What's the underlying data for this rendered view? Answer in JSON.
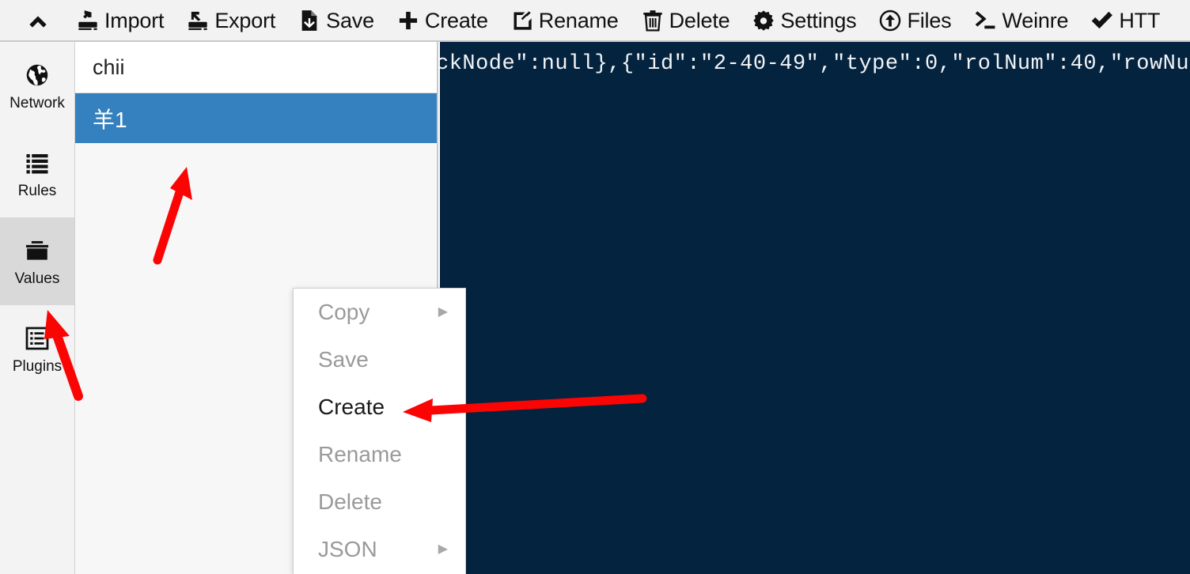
{
  "toolbar": {
    "collapse_icon": "chevron-up-icon",
    "items": [
      {
        "label": "Import",
        "icon": "import-tray-icon"
      },
      {
        "label": "Export",
        "icon": "export-tray-icon"
      },
      {
        "label": "Save",
        "icon": "save-file-icon"
      },
      {
        "label": "Create",
        "icon": "plus-icon"
      },
      {
        "label": "Rename",
        "icon": "edit-square-icon"
      },
      {
        "label": "Delete",
        "icon": "trash-icon"
      },
      {
        "label": "Settings",
        "icon": "gear-icon"
      },
      {
        "label": "Files",
        "icon": "circle-up-arrow-icon"
      },
      {
        "label": "Weinre",
        "icon": "terminal-prompt-icon"
      },
      {
        "label": "HTT",
        "icon": "checkmark-icon"
      }
    ]
  },
  "sidebar": {
    "items": [
      {
        "label": "Network",
        "icon": "globe-icon",
        "active": false
      },
      {
        "label": "Rules",
        "icon": "list-icon",
        "active": false
      },
      {
        "label": "Values",
        "icon": "briefcase-icon",
        "active": true
      },
      {
        "label": "Plugins",
        "icon": "plugins-list-icon",
        "active": false
      }
    ]
  },
  "list_panel": {
    "header_label": "chii",
    "rows": [
      {
        "label": "羊1",
        "selected": true
      }
    ]
  },
  "editor": {
    "content": "ckNode\":null},{\"id\":\"2-40-49\",\"type\":0,\"rolNum\":40,\"rowNu"
  },
  "context_menu": {
    "items": [
      {
        "label": "Copy",
        "enabled": false,
        "submenu": true,
        "arrow": "▶"
      },
      {
        "label": "Save",
        "enabled": false,
        "submenu": false,
        "arrow": ""
      },
      {
        "label": "Create",
        "enabled": true,
        "submenu": false,
        "arrow": ""
      },
      {
        "label": "Rename",
        "enabled": false,
        "submenu": false,
        "arrow": ""
      },
      {
        "label": "Delete",
        "enabled": false,
        "submenu": false,
        "arrow": ""
      },
      {
        "label": "JSON",
        "enabled": false,
        "submenu": true,
        "arrow": "▶"
      }
    ]
  },
  "annotations": {
    "color": "#fb0404",
    "arrows": [
      {
        "name": "arrow-to-values-list",
        "points_to": "values list area"
      },
      {
        "name": "arrow-to-values-tab",
        "points_to": "Values sidebar tab"
      },
      {
        "name": "arrow-to-create-menu-item",
        "points_to": "Create context menu item"
      }
    ]
  },
  "colors": {
    "toolbar_bg": "#f2f2f2",
    "sidebar_bg": "#f3f3f3",
    "sidebar_active_bg": "#d9d9d9",
    "selected_row_bg": "#3580be",
    "editor_bg": "#04233f",
    "annotation_red": "#fb0404"
  }
}
